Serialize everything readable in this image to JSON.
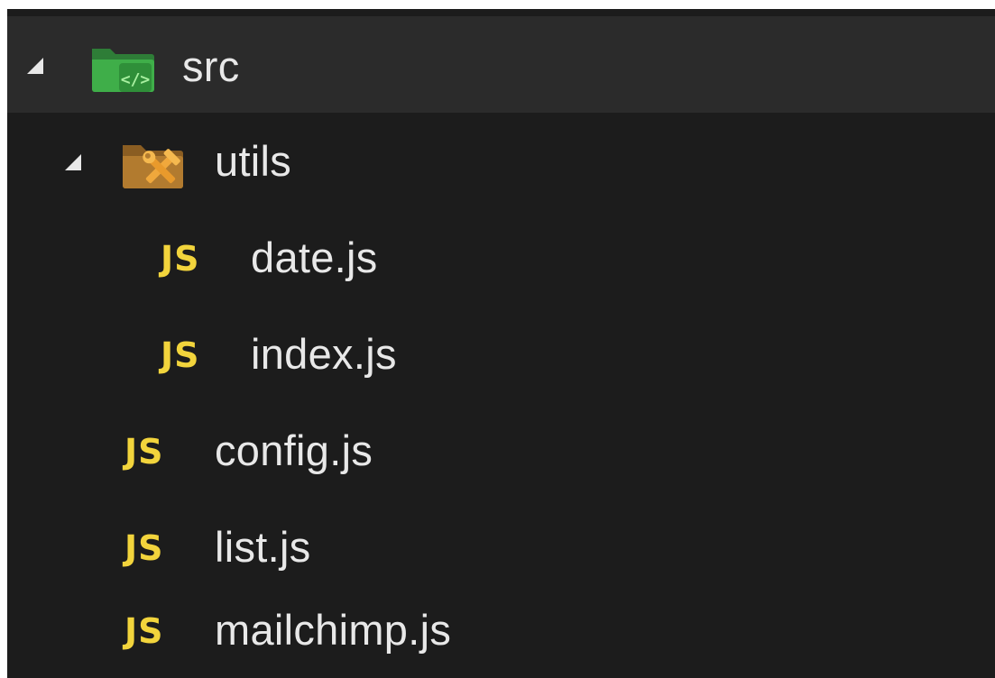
{
  "explorer": {
    "tree": [
      {
        "label": "src",
        "type": "folder",
        "expanded": true,
        "icon": "folder-src-icon"
      },
      {
        "label": "utils",
        "type": "folder",
        "expanded": true,
        "icon": "folder-utils-icon"
      },
      {
        "label": "date.js",
        "type": "file",
        "icon": "js-file-icon",
        "badge": "JS"
      },
      {
        "label": "index.js",
        "type": "file",
        "icon": "js-file-icon",
        "badge": "JS"
      },
      {
        "label": "config.js",
        "type": "file",
        "icon": "js-file-icon",
        "badge": "JS"
      },
      {
        "label": "list.js",
        "type": "file",
        "icon": "js-file-icon",
        "badge": "JS"
      },
      {
        "label": "mailchimp.js",
        "type": "file",
        "icon": "js-file-icon",
        "badge": "JS"
      }
    ]
  },
  "colors": {
    "background": "#1c1c1c",
    "selected_row": "#2b2b2b",
    "text": "#e8e8e8",
    "js_badge": "#f2d43c",
    "folder_src": "#3fae49",
    "folder_utils": "#d99b3a"
  }
}
